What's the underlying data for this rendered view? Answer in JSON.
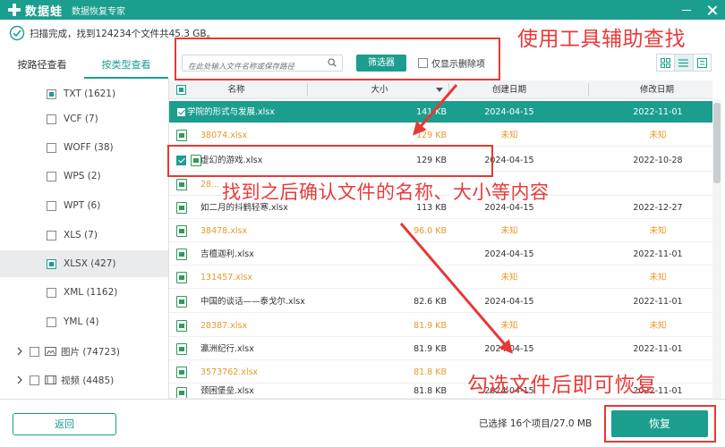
{
  "app": {
    "name": "数据蛙",
    "subtitle": "数据恢复专家"
  },
  "scan": {
    "status": "扫描完成，找到124234个文件共45.3 GB。"
  },
  "annotations": {
    "tools_hint": "使用工具辅助查找",
    "confirm_hint": "找到之后确认文件的名称、大小等内容",
    "recover_hint": "勾选文件后即可恢复"
  },
  "tabs": {
    "by_path": "按路径查看",
    "by_type": "按类型查看"
  },
  "filter": {
    "search_placeholder": "在此处输入文件名称或保存路径",
    "filter_button": "筛选器",
    "show_deleted_only": "仅显示删除项"
  },
  "sidebar": {
    "items": [
      {
        "label": "TXT (1621)"
      },
      {
        "label": "VCF (7)"
      },
      {
        "label": "WOFF (38)"
      },
      {
        "label": "WPS (2)"
      },
      {
        "label": "WPT (6)"
      },
      {
        "label": "XLS (7)"
      },
      {
        "label": "XLSX (427)"
      },
      {
        "label": "XML (1162)"
      },
      {
        "label": "YML (4)"
      },
      {
        "label": "图片 (74723)"
      },
      {
        "label": "视频 (4485)"
      }
    ]
  },
  "table": {
    "headers": {
      "name": "名称",
      "size": "大小",
      "created": "创建日期",
      "modified": "修改日期"
    },
    "rows": [
      {
        "name": "学院的形式与发展.xlsx",
        "size": "141 KB",
        "created": "2024-04-15",
        "modified": "2022-11-01"
      },
      {
        "name": "38074.xlsx",
        "size": "129 KB",
        "created": "未知",
        "modified": "未知"
      },
      {
        "name": "虚幻的游戏.xlsx",
        "size": "129 KB",
        "created": "2024-04-15",
        "modified": "2022-10-28"
      },
      {
        "name": "28...",
        "size": "",
        "created": "",
        "modified": ""
      },
      {
        "name": "如二月的抖鹤轻寒.xlsx",
        "size": "113 KB",
        "created": "2024-04-15",
        "modified": "2022-12-27"
      },
      {
        "name": "38478.xlsx",
        "size": "96.0 KB",
        "created": "未知",
        "modified": "未知"
      },
      {
        "name": "吉檀迦利.xlsx",
        "size": "",
        "created": "2024-04-15",
        "modified": "2022-11-01"
      },
      {
        "name": "131457.xlsx",
        "size": "",
        "created": "未知",
        "modified": "未知"
      },
      {
        "name": "中国的谈话——泰戈尔.xlsx",
        "size": "82.6 KB",
        "created": "2024-04-15",
        "modified": "2022-11-01"
      },
      {
        "name": "28387.xlsx",
        "size": "81.9 KB",
        "created": "未知",
        "modified": "未知"
      },
      {
        "name": "瀛洲纪行.xlsx",
        "size": "81.9 KB",
        "created": "2024-04-15",
        "modified": "2022-11-01"
      },
      {
        "name": "3573762.xlsx",
        "size": "81.8 KB",
        "created": "",
        "modified": ""
      },
      {
        "name": "颈困堡垒.xlsx",
        "size": "81.8 KB",
        "created": "2024-04-15",
        "modified": "2022-11-01"
      }
    ]
  },
  "footer": {
    "back": "返回",
    "selected_info": "已选择 16个项目/27.0 MB",
    "recover": "恢复"
  },
  "colors": {
    "brand": "#1c9e8f",
    "highlight": "#e53935",
    "unknown_orange": "#e69a2b"
  }
}
